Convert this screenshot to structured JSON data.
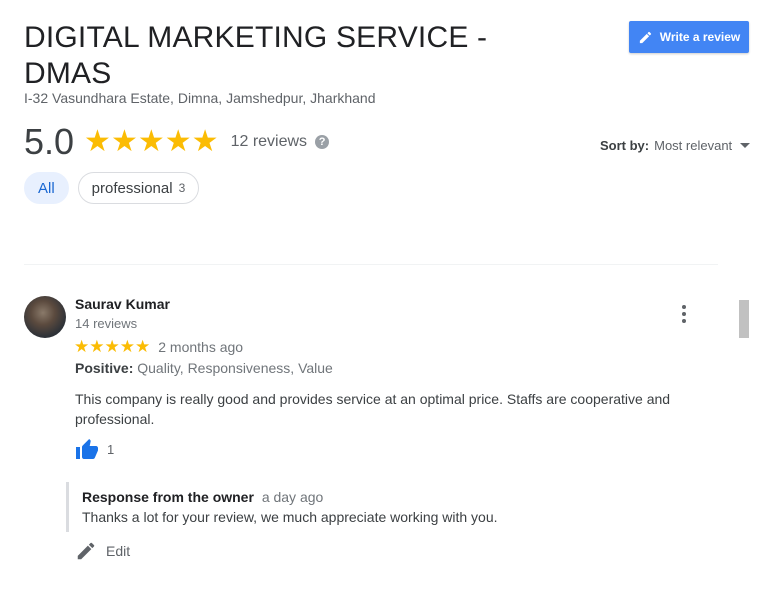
{
  "business": {
    "name": "DIGITAL MARKETING SERVICE - DMAS",
    "address": "I-32 Vasundhara Estate, Dimna, Jamshedpur, Jharkhand"
  },
  "write_review": {
    "label": "Write a review",
    "icon": "pencil-icon"
  },
  "summary": {
    "rating": "5.0",
    "stars": 5,
    "review_count": "12 reviews",
    "help_icon": "?"
  },
  "sort": {
    "label": "Sort by:",
    "value": "Most relevant"
  },
  "filters": [
    {
      "label": "All",
      "count": "",
      "selected": true
    },
    {
      "label": "professional",
      "count": "3",
      "selected": false
    }
  ],
  "review": {
    "author": "Saurav Kumar",
    "author_reviews": "14 reviews",
    "stars": 5,
    "time": "2 months ago",
    "positive_label": "Positive:",
    "positive_values": "Quality, Responsiveness, Value",
    "text": "This company is really good and provides service at an optimal price. Staffs are cooperative and professional.",
    "likes": "1",
    "owner_response": {
      "title": "Response from the owner",
      "time": "a day ago",
      "text": "Thanks a lot for your review, we much appreciate working with you."
    },
    "edit_label": "Edit"
  },
  "colors": {
    "accent": "#4285f4",
    "star": "#fbbc04",
    "like": "#1a73e8",
    "chip_active_bg": "#e8f0fe"
  }
}
